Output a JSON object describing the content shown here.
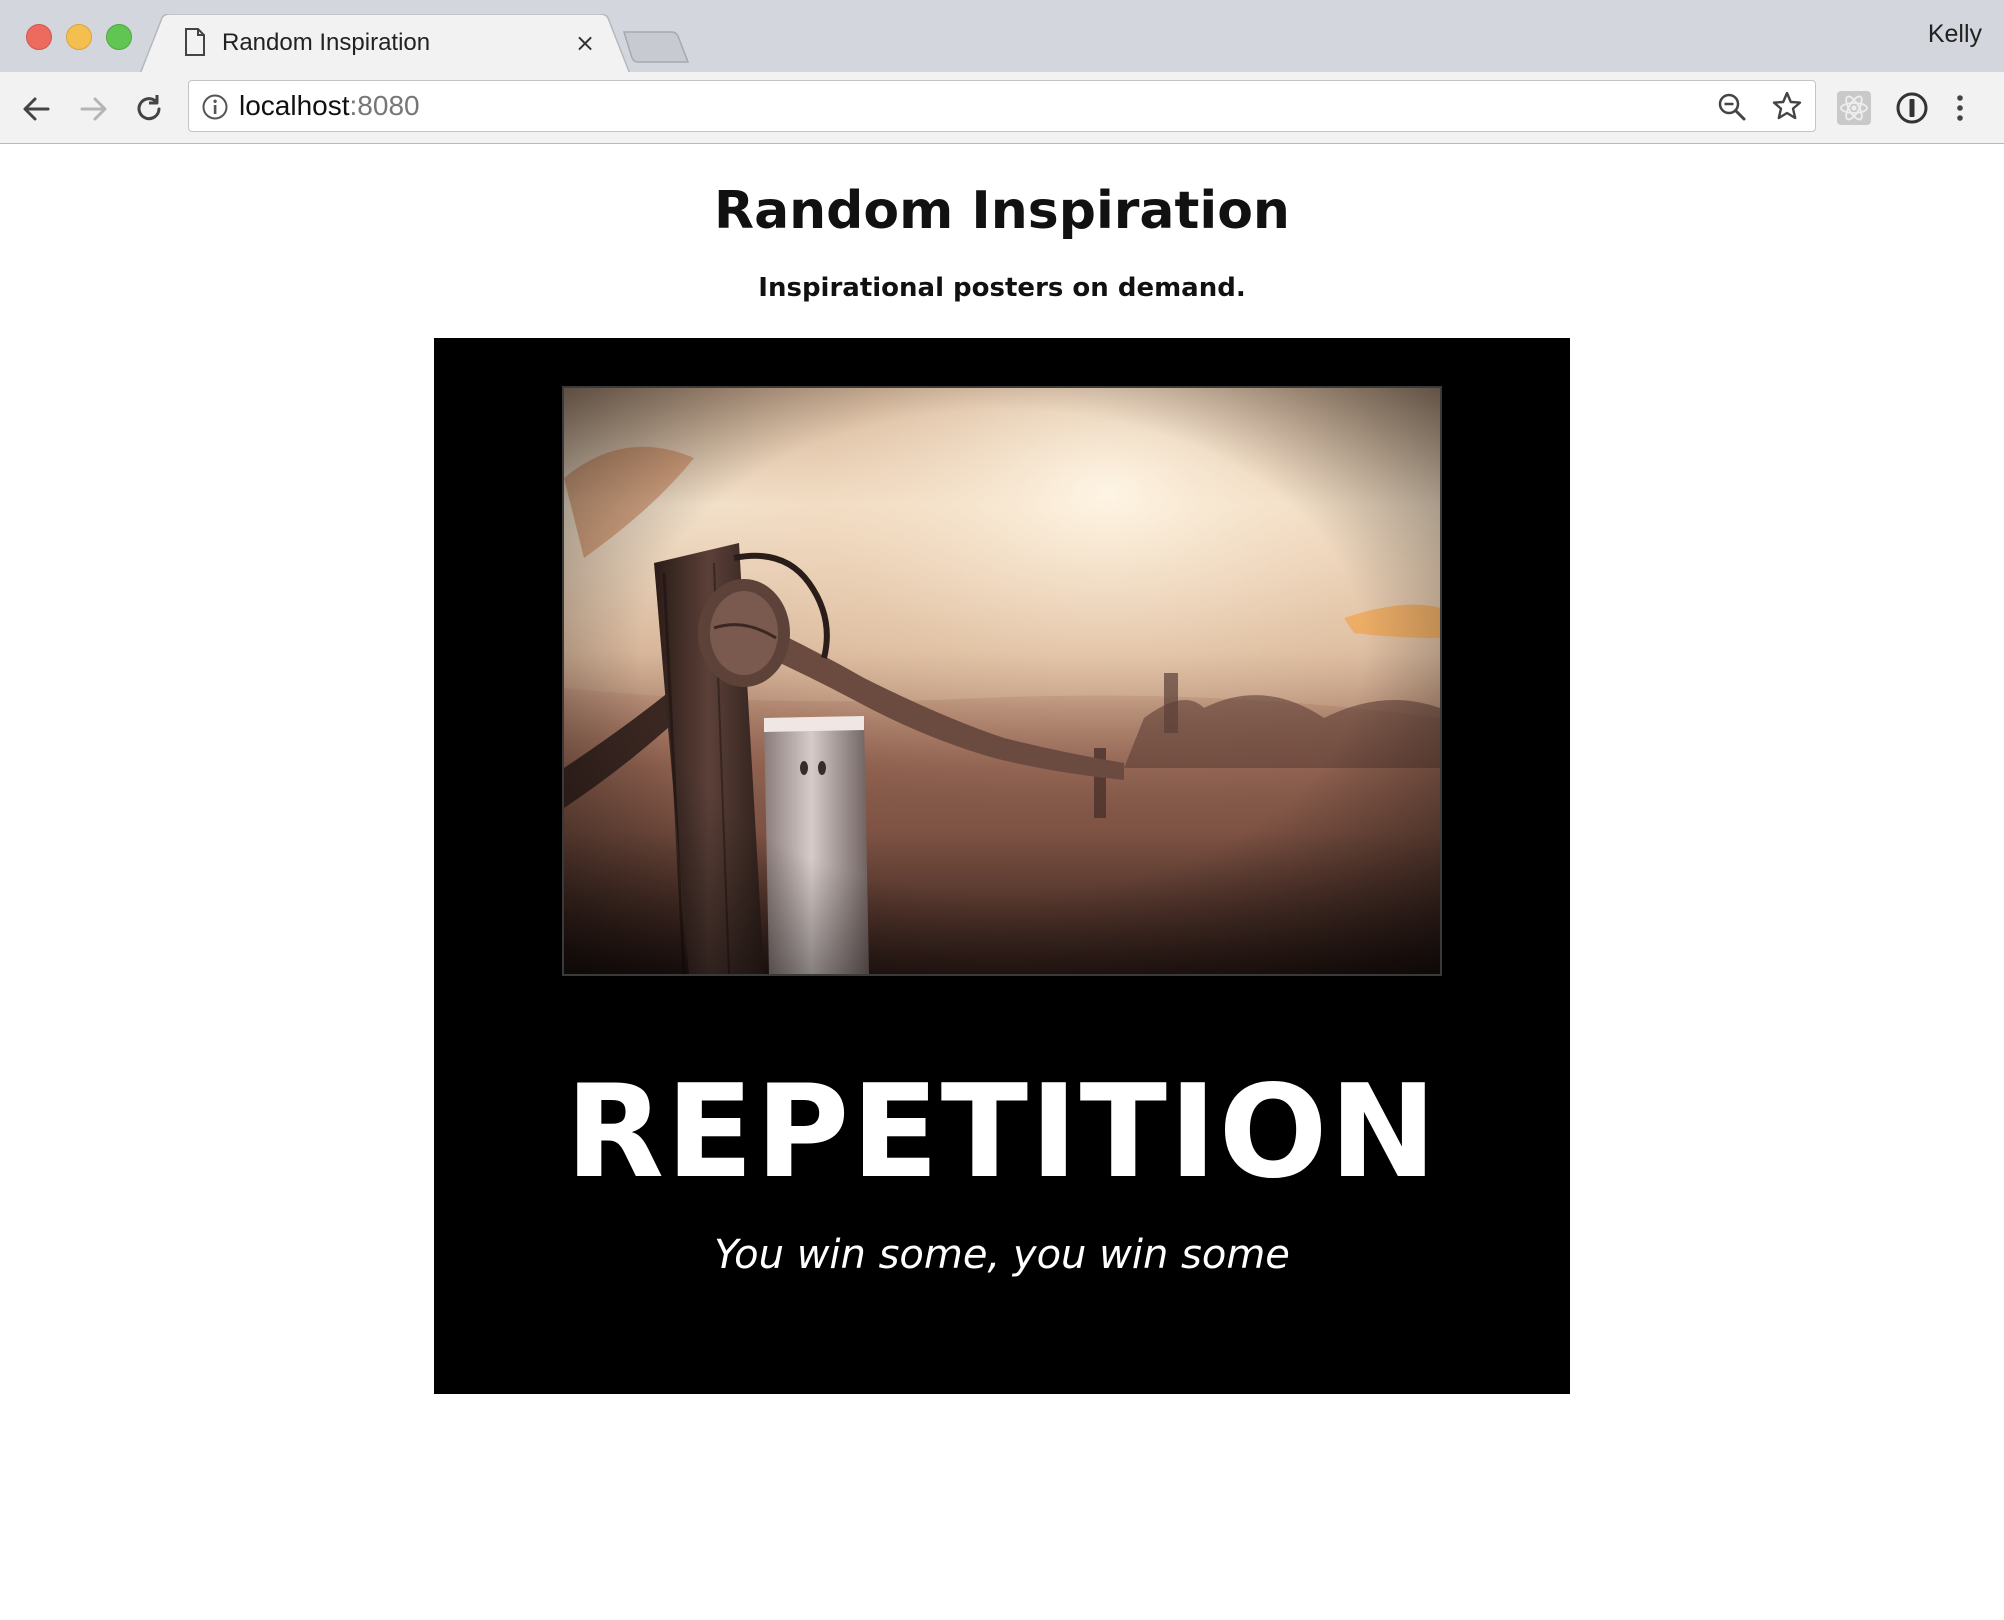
{
  "browser": {
    "tab": {
      "title": "Random Inspiration",
      "close_symbol": "×",
      "icon": "document-icon"
    },
    "profile_name": "Kelly",
    "address_bar": {
      "host": "localhost",
      "port": ":8080"
    },
    "window_controls": [
      "close",
      "minimize",
      "maximize"
    ],
    "icons": [
      "back-arrow-icon",
      "forward-arrow-icon",
      "reload-icon",
      "info-icon",
      "zoom-out-icon",
      "bookmark-star-icon",
      "react-devtools-icon",
      "password-manager-icon",
      "menu-kebab-icon"
    ]
  },
  "page": {
    "title": "Random Inspiration",
    "subtitle": "Inspirational posters on demand.",
    "poster": {
      "heading": "REPETITION",
      "caption": "You win some, you win some"
    }
  },
  "colors": {
    "poster_background": "#000000",
    "page_background": "#ffffff",
    "chrome_titlebar": "#d3d6dc",
    "chrome_toolbar": "#f2f2f2"
  }
}
